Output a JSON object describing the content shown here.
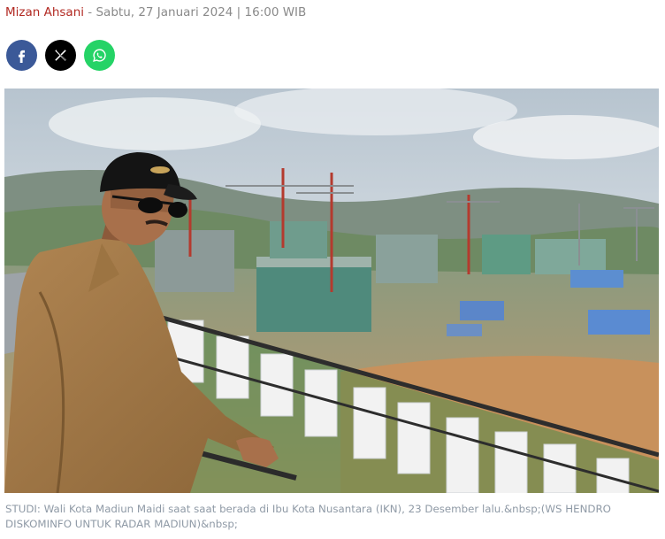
{
  "byline": {
    "author": "Mizan Ahsani",
    "separator": " - ",
    "datetime": "Sabtu, 27 Januari 2024 | 16:00 WIB"
  },
  "share": {
    "buttons": [
      {
        "name": "facebook",
        "icon": "facebook-icon",
        "color": "#3b5998"
      },
      {
        "name": "x",
        "icon": "x-icon",
        "color": "#000000"
      },
      {
        "name": "whatsapp",
        "icon": "whatsapp-icon",
        "color": "#25d366"
      }
    ]
  },
  "photo": {
    "caption": "STUDI: Wali Kota Madiun Maidi saat saat berada di Ibu Kota Nusantara (IKN), 23 Desember lalu.&nbsp;(WS HENDRO DISKOMINFO UNTUK RADAR MADIUN)&nbsp;"
  }
}
